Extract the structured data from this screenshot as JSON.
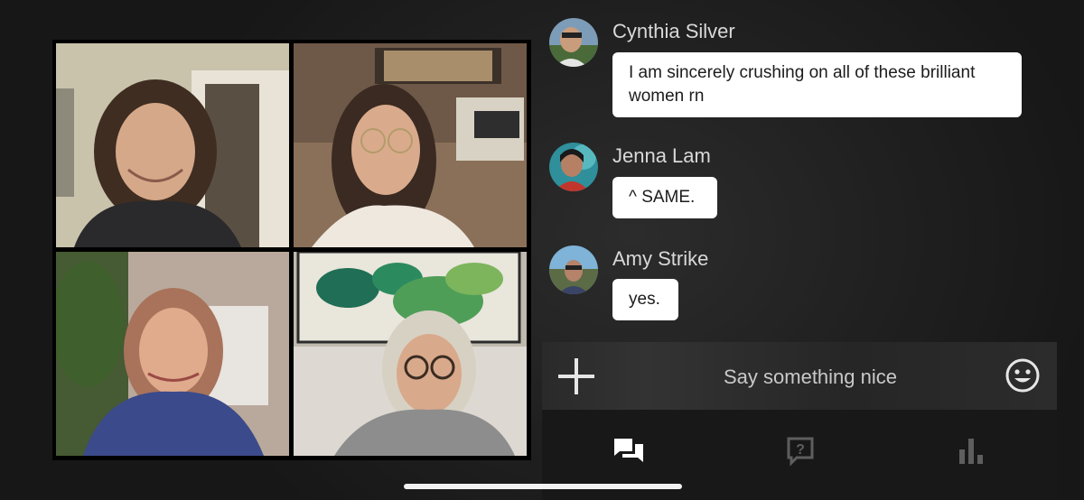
{
  "chat": {
    "messages": [
      {
        "sender": "Cynthia Silver",
        "text": "I am sincerely crushing on all of these brilliant women rn"
      },
      {
        "sender": "Jenna Lam",
        "text": "^ SAME."
      },
      {
        "sender": "Amy Strike",
        "text": "yes."
      }
    ]
  },
  "input": {
    "placeholder": "Say something nice",
    "add_icon": "plus-icon",
    "emoji_icon": "smiley-icon"
  },
  "tabs": [
    {
      "icon": "chat-bubbles-icon",
      "active": true
    },
    {
      "icon": "question-icon",
      "active": false
    },
    {
      "icon": "bar-chart-icon",
      "active": false
    }
  ],
  "colors": {
    "background": "#1e1e1e",
    "bubble": "#ffffff",
    "active_tab": "#ffffff",
    "inactive_tab": "#5e5e5e"
  }
}
